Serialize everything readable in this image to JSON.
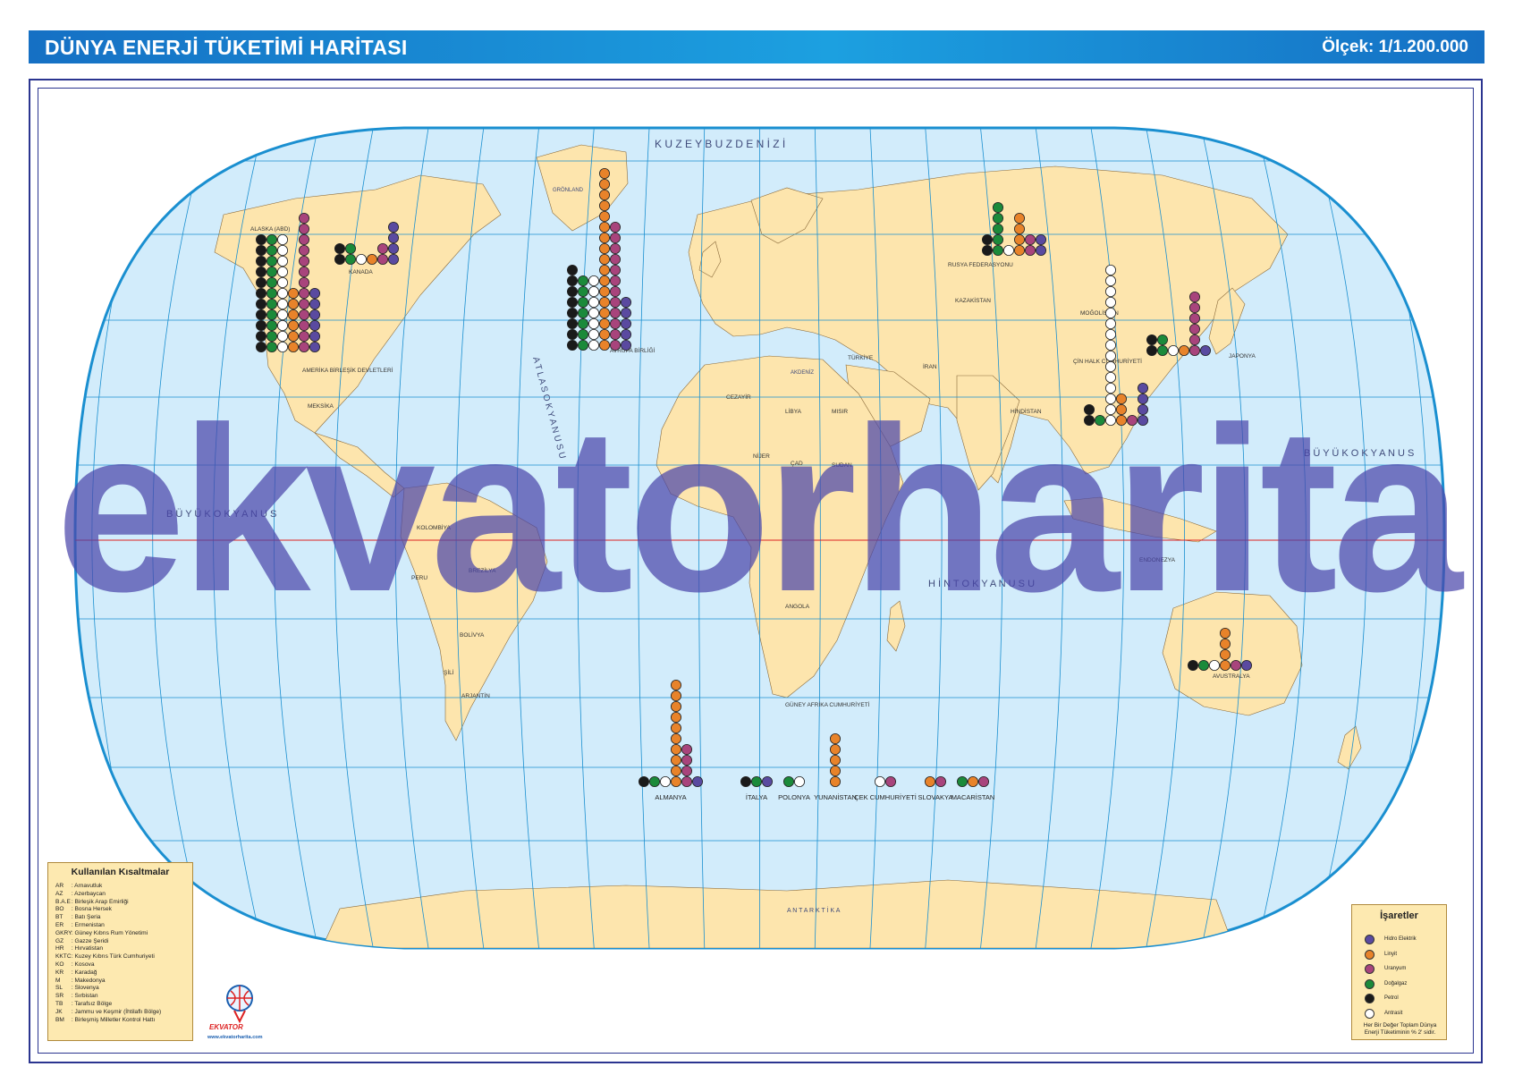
{
  "header": {
    "title": "DÜNYA ENERJİ TÜKETİMİ HARİTASI",
    "scale": "Ölçek: 1/1.200.000"
  },
  "colors": {
    "ocean": "#d2ecfb",
    "land": "#fde5ad",
    "grid": "#1a8fd0",
    "border": "#2b3590",
    "header": "#1a8fd6"
  },
  "oceans": [
    {
      "id": "arctic",
      "label": "K U Z E Y   B U Z   D E N İ Z İ"
    },
    {
      "id": "atlantic",
      "label": "A T L A S   O K Y A N U S U"
    },
    {
      "id": "pacific-w",
      "label": "B Ü Y Ü K   O K Y A N U S"
    },
    {
      "id": "pacific-e",
      "label": "B Ü Y Ü K   O K Y A N U S"
    },
    {
      "id": "indian",
      "label": "H İ N T   O K Y A N U S U"
    },
    {
      "id": "mediterranean",
      "label": "AKDENİZ"
    },
    {
      "id": "antarctica",
      "label": "A N T A R K T İ K A"
    },
    {
      "id": "greenland",
      "label": "GRÖNLAND"
    }
  ],
  "countries": [
    {
      "id": "usa",
      "label": "AMERİKA BİRLEŞİK DEVLETLERİ"
    },
    {
      "id": "alaska",
      "label": "ALASKA (ABD)"
    },
    {
      "id": "canada",
      "label": "KANADA"
    },
    {
      "id": "mexico",
      "label": "MEKSİKA"
    },
    {
      "id": "kolombiya",
      "label": "KOLOMBİYA"
    },
    {
      "id": "brezilya",
      "label": "BREZİLYA"
    },
    {
      "id": "peru",
      "label": "PERU"
    },
    {
      "id": "arjantin",
      "label": "ARJANTİN"
    },
    {
      "id": "sili",
      "label": "ŞİLİ"
    },
    {
      "id": "bolivya",
      "label": "BOLİVYA"
    },
    {
      "id": "rusya",
      "label": "RUSYA FEDERASYONU"
    },
    {
      "id": "kazakistan",
      "label": "KAZAKİSTAN"
    },
    {
      "id": "mogolistan",
      "label": "MOĞOLİSTAN"
    },
    {
      "id": "cin",
      "label": "ÇİN HALK CUMHURİYETİ"
    },
    {
      "id": "hindistan",
      "label": "HİNDİSTAN"
    },
    {
      "id": "iran",
      "label": "İRAN"
    },
    {
      "id": "turkiye",
      "label": "TÜRKİYE"
    },
    {
      "id": "misir",
      "label": "MISIR"
    },
    {
      "id": "libya",
      "label": "LİBYA"
    },
    {
      "id": "cezayir",
      "label": "CEZAYİR"
    },
    {
      "id": "nijer",
      "label": "NİJER"
    },
    {
      "id": "cad",
      "label": "ÇAD"
    },
    {
      "id": "sudan",
      "label": "SUDAN"
    },
    {
      "id": "angola",
      "label": "ANGOLA"
    },
    {
      "id": "guneyafrika",
      "label": "GÜNEY AFRİKA CUMHURİYETİ"
    },
    {
      "id": "avustralya",
      "label": "AVUSTRALYA"
    },
    {
      "id": "japonya",
      "label": "JAPONYA"
    },
    {
      "id": "endonezya",
      "label": "ENDONEZYA"
    },
    {
      "id": "avrupabirligi",
      "label": "AVRUPA BİRLİĞİ"
    }
  ],
  "chart_data": {
    "type": "dot-columns",
    "legend": [
      {
        "key": "hidro",
        "label": "Hidro Elektrik",
        "color": "#5a4aa0"
      },
      {
        "key": "linyit",
        "label": "Linyit",
        "color": "#e8832a"
      },
      {
        "key": "uranyum",
        "label": "Uranyum",
        "color": "#a8447c"
      },
      {
        "key": "dogalgaz",
        "label": "Doğalgaz",
        "color": "#1b8a3a"
      },
      {
        "key": "petrol",
        "label": "Petrol",
        "color": "#1a1a1a"
      },
      {
        "key": "antrasit",
        "label": "Antrasit",
        "color": "#ffffff"
      }
    ],
    "note": "Her Bir Değer Toplam Dünya Enerji Tüketiminin % 2' sidir.",
    "groups": [
      {
        "name": "AMERİKA BİRLEŞİK DEVLETLERİ",
        "petrol": 11,
        "dogalgaz": 11,
        "antrasit": 11,
        "linyit": 6,
        "uranyum": 13,
        "hidro": 6
      },
      {
        "name": "KANADA",
        "petrol": 2,
        "dogalgaz": 2,
        "antrasit": 1,
        "linyit": 1,
        "uranyum": 2,
        "hidro": 4
      },
      {
        "name": "AVRUPA BİRLİĞİ",
        "petrol": 8,
        "dogalgaz": 7,
        "antrasit": 7,
        "linyit": 17,
        "uranyum": 12,
        "hidro": 5
      },
      {
        "name": "RUSYA FEDERASYONU",
        "petrol": 2,
        "dogalgaz": 5,
        "antrasit": 1,
        "linyit": 4,
        "uranyum": 2,
        "hidro": 2
      },
      {
        "name": "ÇİN HALK CUMHURİYETİ",
        "petrol": 2,
        "dogalgaz": 1,
        "antrasit": 15,
        "linyit": 3,
        "uranyum": 1,
        "hidro": 4
      },
      {
        "name": "JAPONYA",
        "petrol": 2,
        "dogalgaz": 2,
        "antrasit": 1,
        "linyit": 1,
        "uranyum": 6,
        "hidro": 1
      },
      {
        "name": "AVUSTRALYA",
        "petrol": 1,
        "dogalgaz": 1,
        "antrasit": 1,
        "linyit": 4,
        "uranyum": 1,
        "hidro": 1
      },
      {
        "name": "ALMANYA",
        "petrol": 1,
        "dogalgaz": 1,
        "antrasit": 1,
        "linyit": 10,
        "uranyum": 4,
        "hidro": 1
      },
      {
        "name": "İTALYA",
        "petrol": 1,
        "dogalgaz": 1,
        "antrasit": 0,
        "linyit": 0,
        "uranyum": 0,
        "hidro": 1
      },
      {
        "name": "POLONYA",
        "petrol": 0,
        "dogalgaz": 1,
        "antrasit": 1,
        "linyit": 0,
        "uranyum": 0,
        "hidro": 0
      },
      {
        "name": "YUNANİSTAN",
        "petrol": 0,
        "dogalgaz": 0,
        "antrasit": 0,
        "linyit": 5,
        "uranyum": 0,
        "hidro": 0
      },
      {
        "name": "ÇEK CUMHURİYETİ",
        "petrol": 0,
        "dogalgaz": 0,
        "antrasit": 1,
        "linyit": 0,
        "uranyum": 1,
        "hidro": 0
      },
      {
        "name": "SLOVAKYA",
        "petrol": 0,
        "dogalgaz": 0,
        "antrasit": 0,
        "linyit": 1,
        "uranyum": 1,
        "hidro": 0
      },
      {
        "name": "MACARİSTAN",
        "petrol": 0,
        "dogalgaz": 1,
        "antrasit": 0,
        "linyit": 1,
        "uranyum": 1,
        "hidro": 0
      }
    ]
  },
  "abbreviations": {
    "title": "Kullanılan Kısaltmalar",
    "items": [
      {
        "code": "AR",
        "name": ": Arnavutluk"
      },
      {
        "code": "AZ",
        "name": ": Azerbaycan"
      },
      {
        "code": "B.A.E",
        "name": ": Birleşik Arap Emirliği"
      },
      {
        "code": "BO",
        "name": ": Bosna Hersek"
      },
      {
        "code": "BT",
        "name": ": Batı Şeria"
      },
      {
        "code": "ER",
        "name": ": Ermenistan"
      },
      {
        "code": "GKRY",
        "name": ": Güney Kıbrıs Rum Yönetimi"
      },
      {
        "code": "GZ",
        "name": ": Gazze Şeridi"
      },
      {
        "code": "HR",
        "name": ": Hırvatistan"
      },
      {
        "code": "KKTC",
        "name": ": Kuzey Kıbrıs Türk Cumhuriyeti"
      },
      {
        "code": "KO",
        "name": ": Kosova"
      },
      {
        "code": "KR",
        "name": ": Karadağ"
      },
      {
        "code": "M",
        "name": ": Makedonya"
      },
      {
        "code": "SL",
        "name": ": Slovenya"
      },
      {
        "code": "SR",
        "name": ": Sırbistan"
      },
      {
        "code": "TB",
        "name": ": Tarafsız Bölge"
      },
      {
        "code": "JK",
        "name": ": Jammu ve Keşmir (İhtilaflı Bölge)"
      },
      {
        "code": "BM",
        "name": ": Birleşmiş Milletler Kontrol Hattı"
      }
    ]
  },
  "legend": {
    "title": "İşaretler"
  },
  "logo": {
    "brand": "EKVATOR",
    "url": "www.ekvatorharita.com"
  },
  "watermark": "ekvatorharita"
}
